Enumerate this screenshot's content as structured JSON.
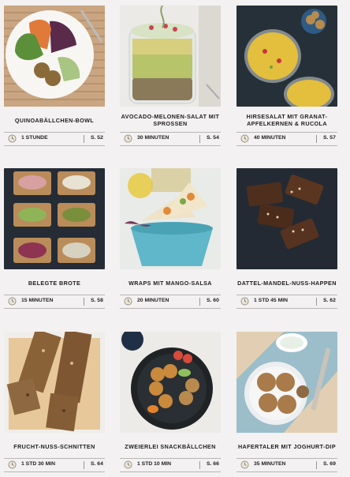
{
  "recipes": [
    {
      "title": "QUINOABÄLLCHEN-BOWL",
      "time": "1 STUNDE",
      "page": "S. 52"
    },
    {
      "title": "AVOCADO-MELONEN-SALAT MIT SPROSSEN",
      "time": "30 MINUTEN",
      "page": "S. 54"
    },
    {
      "title": "HIRSESALAT MIT GRANAT-APFELKERNEN & RUCOLA",
      "time": "40 MINUTEN",
      "page": "S. 57"
    },
    {
      "title": "BELEGTE BROTE",
      "time": "15 MINUTEN",
      "page": "S. 58"
    },
    {
      "title": "WRAPS MIT MANGO-SALSA",
      "time": "20 MINUTEN",
      "page": "S. 60"
    },
    {
      "title": "DATTEL-MANDEL-NUSS-HAPPEN",
      "time": "1 STD 45 MIN",
      "page": "S. 62"
    },
    {
      "title": "FRUCHT-NUSS-SCHNITTEN",
      "time": "1 STD 30 MIN",
      "page": "S. 64"
    },
    {
      "title": "ZWEIERLEI SNACKBÄLLCHEN",
      "time": "1 STD 10 MIN",
      "page": "S. 66"
    },
    {
      "title": "HAFERTALER MIT JOGHURT-DIP",
      "time": "35 MINUTEN",
      "page": "S. 69"
    }
  ],
  "icons": {
    "time": "clock-icon"
  },
  "colors": {
    "background": "#f3f1f1",
    "rule": "#b9b6b6",
    "text": "#1e1e1e"
  }
}
